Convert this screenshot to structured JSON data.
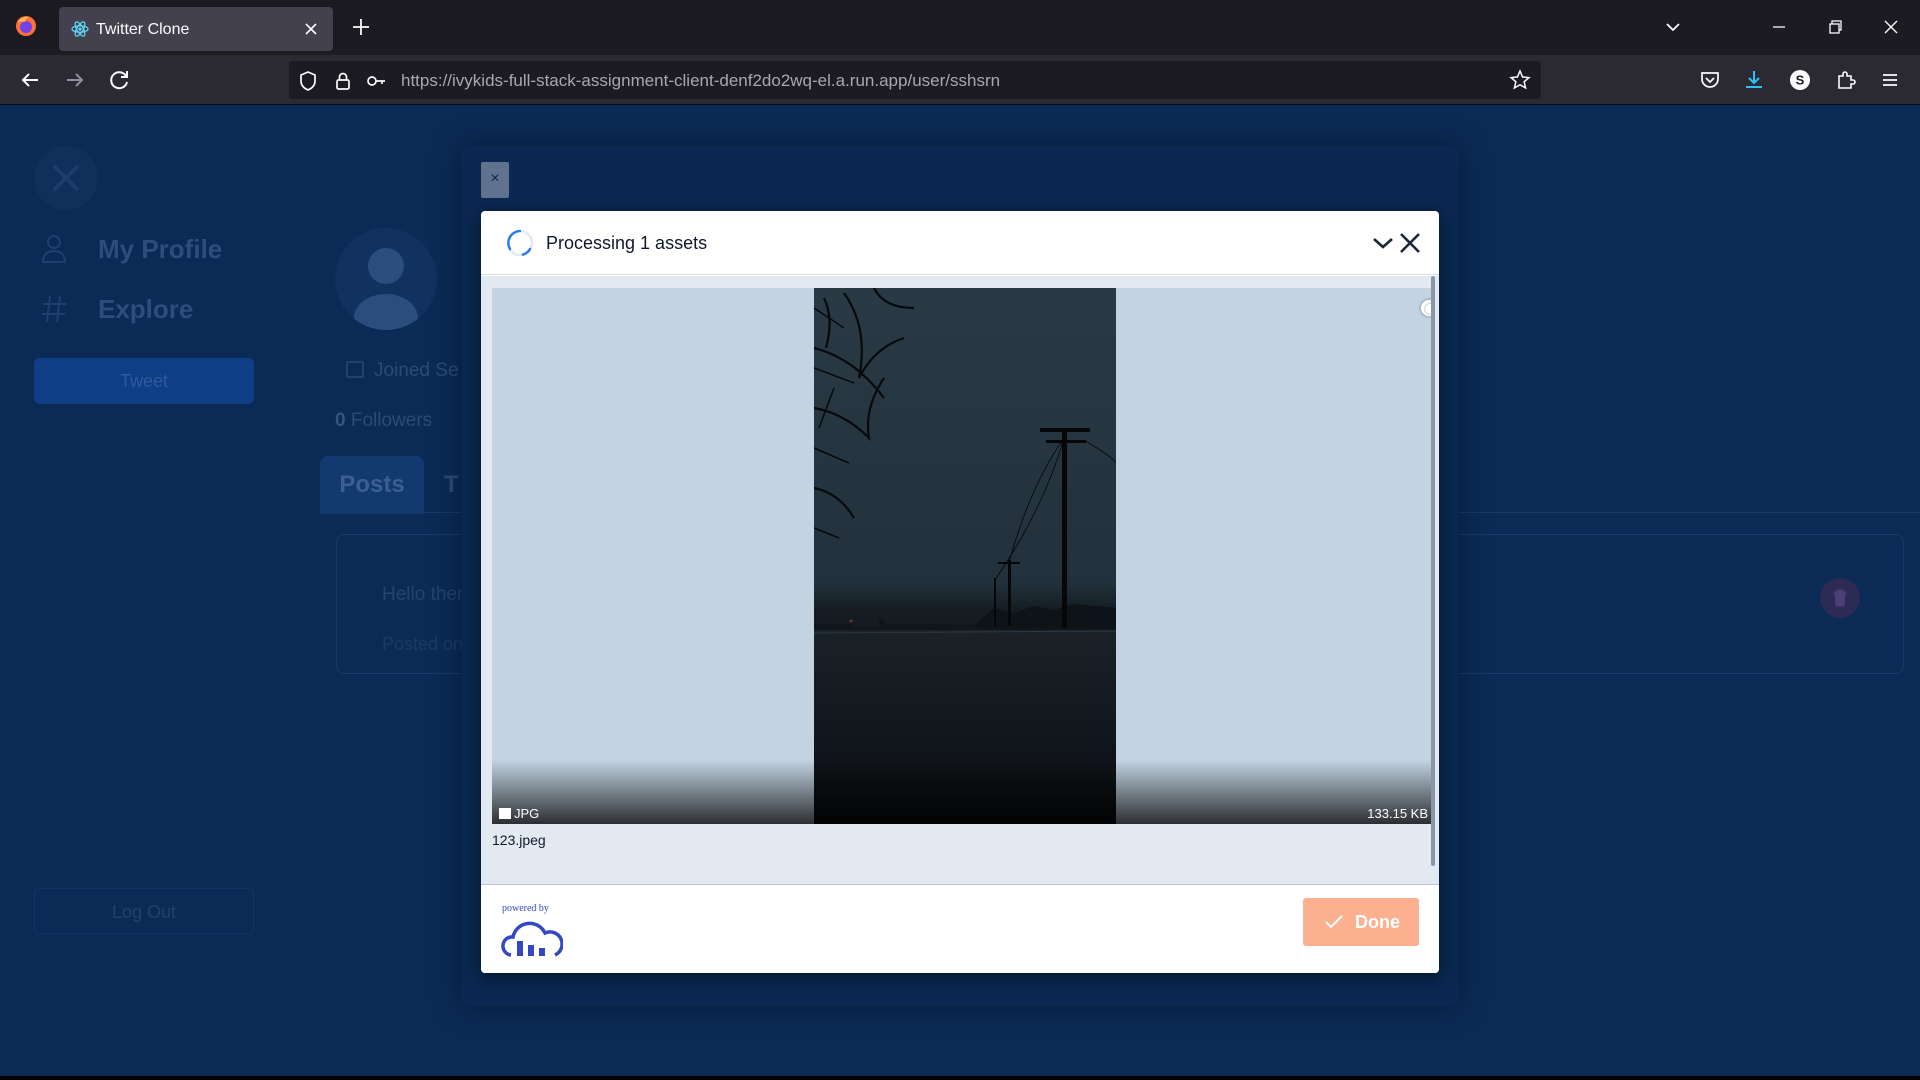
{
  "browser": {
    "tab_title": "Twitter Clone",
    "url_host": "https://ivykids-full-stack-assignment-client-denf2do2wq-el.a.run.app",
    "url_path": "/user/sshsrn"
  },
  "app": {
    "nav": [
      {
        "label": "My Profile",
        "icon": "person-icon"
      },
      {
        "label": "Explore",
        "icon": "hashtag-icon"
      }
    ],
    "tweet_label": "Tweet",
    "logout_label": "Log Out",
    "joined_text": "Joined Se",
    "followers_count": "0",
    "followers_label": "Followers",
    "tabs": [
      "Posts",
      "T"
    ],
    "post_text": "Hello there",
    "post_meta": "Posted on",
    "close_label": "×"
  },
  "upload_widget": {
    "title": "Processing 1 assets",
    "file_type": "JPG",
    "file_size": "133.15 KB",
    "file_name": "123.jpeg",
    "powered_by": "powered by",
    "done_label": "Done",
    "accent_color": "#fcb08f",
    "brand_color": "#3448c5"
  }
}
